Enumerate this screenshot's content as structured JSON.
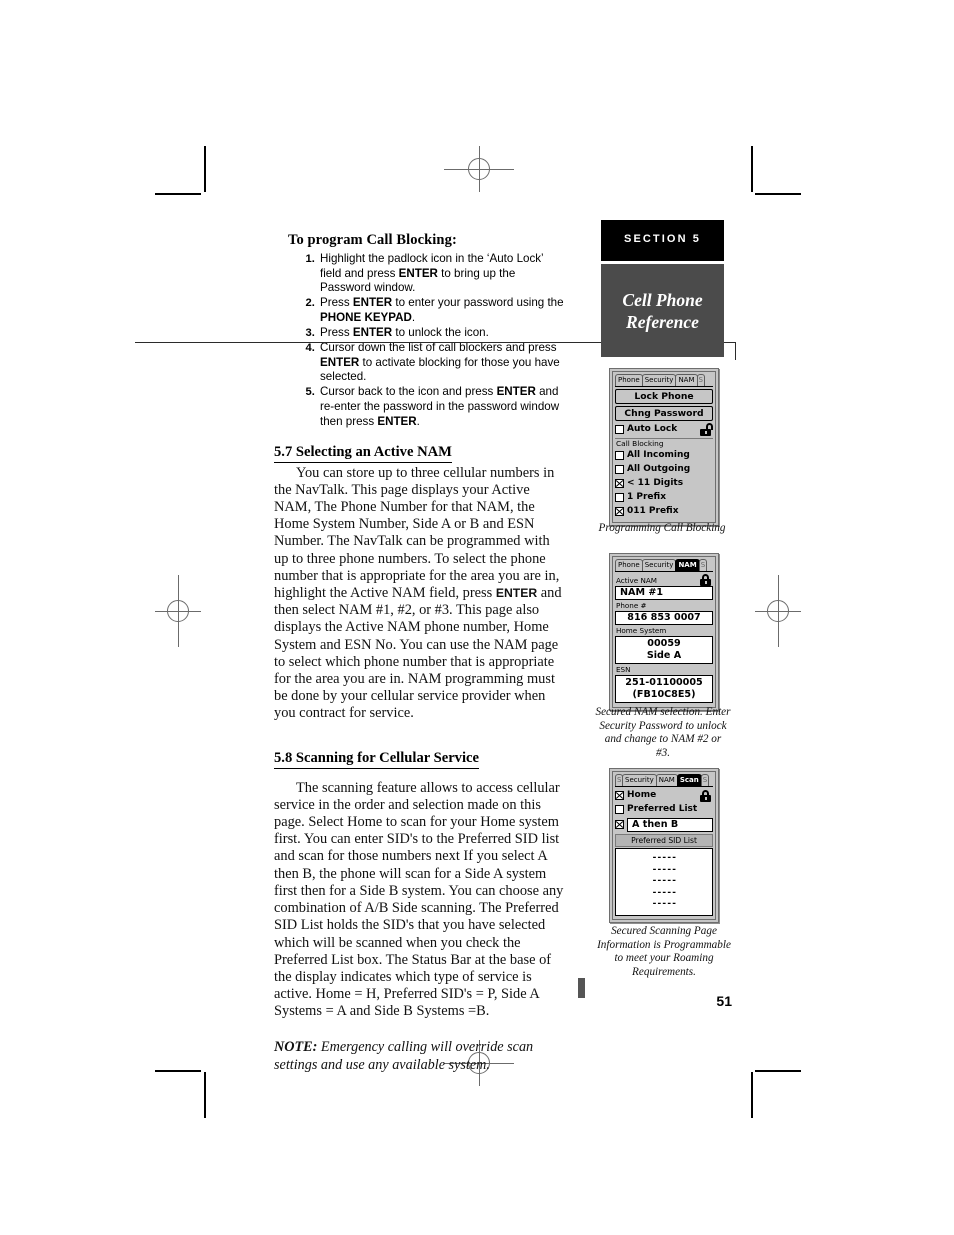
{
  "page": {
    "number": "51"
  },
  "sidebar": {
    "section_label": "SECTION 5",
    "title_line1": "Cell Phone",
    "title_line2": "Reference"
  },
  "left_column": {
    "heading": "To program Call Blocking:",
    "steps": [
      "Highlight the padlock icon in the ‘Auto Lock’ field and press ENTER to bring up the Password window.",
      "Press ENTER to enter your password using the PHONE KEYPAD.",
      "Press ENTER to unlock the icon.",
      "Cursor down the list of call blockers and press ENTER to activate blocking for those you have selected.",
      "Cursor back to the icon and press ENTER and re-enter the password in the password window then press ENTER."
    ],
    "step_parts": {
      "s1a": "Highlight the padlock icon in the ‘Auto Lock’ field and press ",
      "s1k": "ENTER",
      "s1b": " to bring up the Password window.",
      "s2a": "Press ",
      "s2k1": "ENTER",
      "s2b": " to enter your password using the ",
      "s2k2": "PHONE KEYPAD",
      "s2c": ".",
      "s3a": "Press ",
      "s3k": "ENTER",
      "s3b": " to unlock the icon.",
      "s4a": "Cursor down the list of call blockers and press ",
      "s4k": "ENTER",
      "s4b": " to activate blocking for those you have selected.",
      "s5a": "Cursor back to the icon and press ",
      "s5k1": "ENTER",
      "s5b": " and re-enter the password in the password window then press ",
      "s5k2": "ENTER",
      "s5c": "."
    },
    "section_57": {
      "heading": "5.7 Selecting an Active NAM",
      "p_a": "You can store up to three cellular numbers in the NavTalk. This page displays your Active NAM, The Phone Number for that NAM, the Home System Number, Side A or B and ESN Number. The NavTalk can be programmed with up to three phone numbers. To select the phone number that is appropriate for the area you are in, highlight the Active NAM field, press ",
      "p_kbd": "ENTER",
      "p_b": " and then select NAM #1, #2, or #3. This page also displays the Active NAM phone number, Home System and ESN No. You can use the NAM page to select which phone number that is appropriate for the area you are in. NAM programming must be done by your cellular service provider when you contract for service."
    },
    "section_58": {
      "heading": "5.8  Scanning for Cellular Service ",
      "paragraph": "The scanning feature allows to access cellular service in the order and selection made on this page. Select Home to scan for your Home system first. You can enter SID's to the Preferred SID list and scan for those numbers next If you select A then B, the phone will scan for a Side A system first then for a Side B system. You can choose any combination of A/B Side scanning. The Preferred SID List holds the SID's that you have selected which will be scanned when you check the Preferred List box. The Status Bar at the base of the display indicates which type of service is active. Home = H, Preferred SID's = P,  Side A Systems = A and Side B Systems =B.",
      "note_label": "NOTE:",
      "note_text": " Emergency calling will override scan settings and use any available system."
    }
  },
  "devices": [
    {
      "id": "call-blocking",
      "tabs": [
        {
          "label": "Phone",
          "selected": false
        },
        {
          "label": "Security",
          "selected": false
        },
        {
          "label": "NAM",
          "selected": false
        }
      ],
      "buttons": [
        {
          "label": "Lock Phone"
        },
        {
          "label": "Chng Password"
        }
      ],
      "auto_lock": {
        "label": "Auto Lock",
        "checked": false,
        "lock_icon": "padlock-open-icon"
      },
      "group_label": "Call Blocking",
      "options": [
        {
          "label": "All Incoming",
          "checked": false
        },
        {
          "label": "All Outgoing",
          "checked": false
        },
        {
          "label": "< 11 Digits",
          "checked": true
        },
        {
          "label": "1 Prefix",
          "checked": false
        },
        {
          "label": "011 Prefix",
          "checked": true
        }
      ],
      "caption": "Programming Call Blocking"
    },
    {
      "id": "active-nam",
      "tabs": [
        {
          "label": "Phone",
          "selected": false
        },
        {
          "label": "Security",
          "selected": false
        },
        {
          "label": "NAM",
          "selected": true
        }
      ],
      "lock_icon": "padlock-closed-icon",
      "fields": [
        {
          "label": "Active NAM",
          "value": "NAM #1"
        },
        {
          "label": "Phone #",
          "value": "816 853 0007"
        },
        {
          "label": "Home System",
          "value": "00059",
          "value2": "Side A"
        },
        {
          "label": "ESN",
          "value": "251-01100005",
          "value2": "(FB10C8E5)"
        }
      ],
      "caption_lines": [
        "Secured NAM selection. Enter",
        "Security Password to unlock",
        "and  change to NAM #2 or",
        "#3."
      ]
    },
    {
      "id": "scan",
      "tabs": [
        {
          "label": "Security",
          "selected": false
        },
        {
          "label": "NAM",
          "selected": false
        },
        {
          "label": "Scan",
          "selected": true
        }
      ],
      "lock_icon": "padlock-closed-icon",
      "options": [
        {
          "label": "Home",
          "checked": true
        },
        {
          "label": "Preferred List",
          "checked": false
        }
      ],
      "side_order": {
        "checked": true,
        "value": "A then B"
      },
      "list_label": "Preferred SID List",
      "list_rows": [
        "-----",
        "-----",
        "-----",
        "-----",
        "-----"
      ],
      "caption_lines": [
        "Secured  Scanning  Page",
        "Information is Programmable",
        "to meet your Roaming",
        "Requirements."
      ]
    }
  ]
}
